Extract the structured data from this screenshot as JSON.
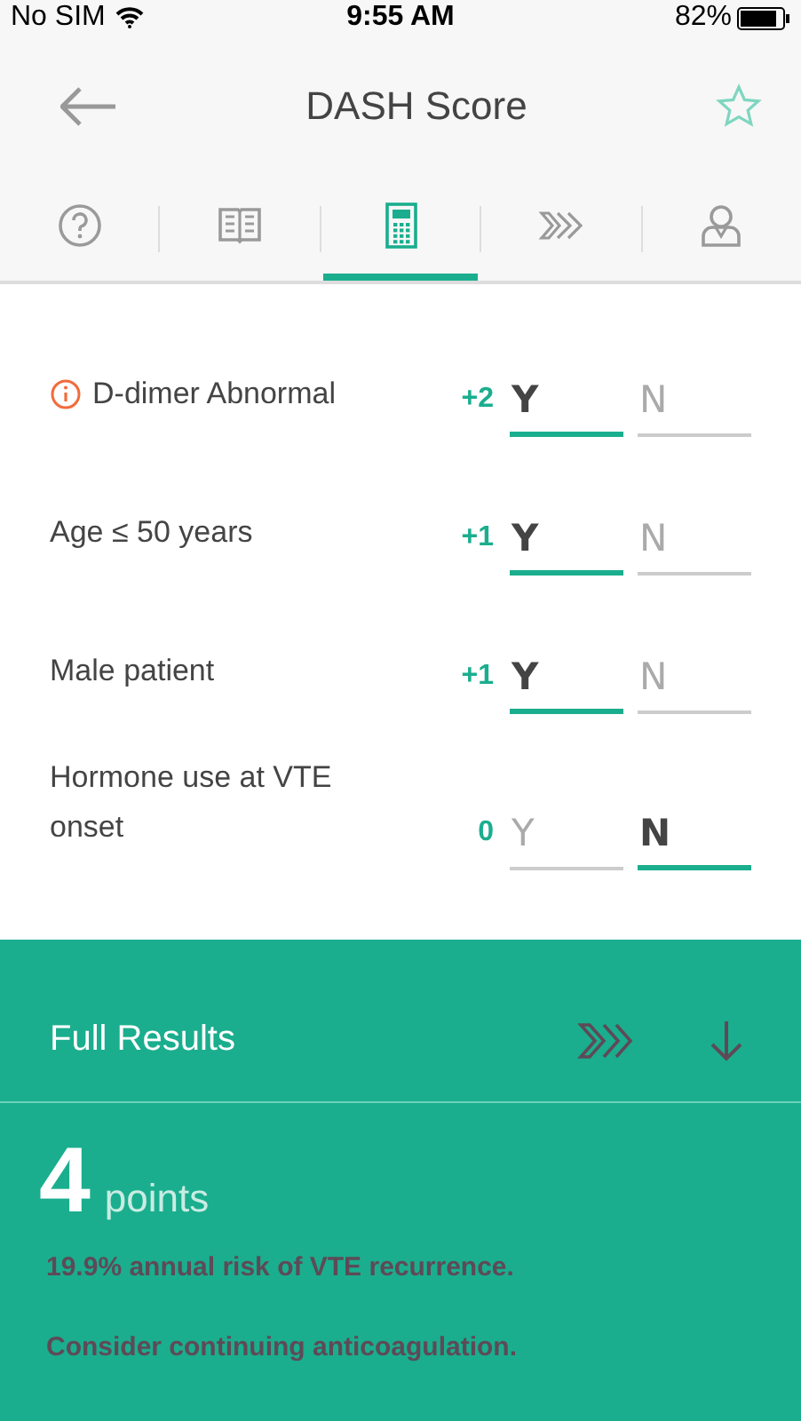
{
  "status_bar": {
    "carrier": "No SIM",
    "time": "9:55 AM",
    "battery": "82%"
  },
  "header": {
    "title": "DASH Score",
    "favorite": false
  },
  "tabs": [
    {
      "kind": "help",
      "selected": false
    },
    {
      "kind": "book",
      "selected": false
    },
    {
      "kind": "calculator",
      "selected": true
    },
    {
      "kind": "chevrons",
      "selected": false
    },
    {
      "kind": "person",
      "selected": false
    }
  ],
  "criteria": [
    {
      "label": "D-dimer Abnormal",
      "info": true,
      "points": "+2",
      "options": [
        {
          "label": "Y",
          "selected": true
        },
        {
          "label": "N",
          "selected": false
        }
      ]
    },
    {
      "label": "Age ≤ 50 years",
      "info": false,
      "points": "+1",
      "options": [
        {
          "label": "Y",
          "selected": true
        },
        {
          "label": "N",
          "selected": false
        }
      ]
    },
    {
      "label": "Male patient",
      "info": false,
      "points": "+1",
      "options": [
        {
          "label": "Y",
          "selected": true
        },
        {
          "label": "N",
          "selected": false
        }
      ]
    },
    {
      "label": "Hormone use at VTE onset",
      "info": false,
      "points": "0",
      "options": [
        {
          "label": "Y",
          "selected": false
        },
        {
          "label": "N",
          "selected": true
        }
      ]
    }
  ],
  "results": {
    "title": "Full Results",
    "score": "4",
    "unit": "points",
    "lines": [
      "19.9% annual risk of VTE recurrence.",
      "Consider continuing anticoagulation."
    ]
  }
}
